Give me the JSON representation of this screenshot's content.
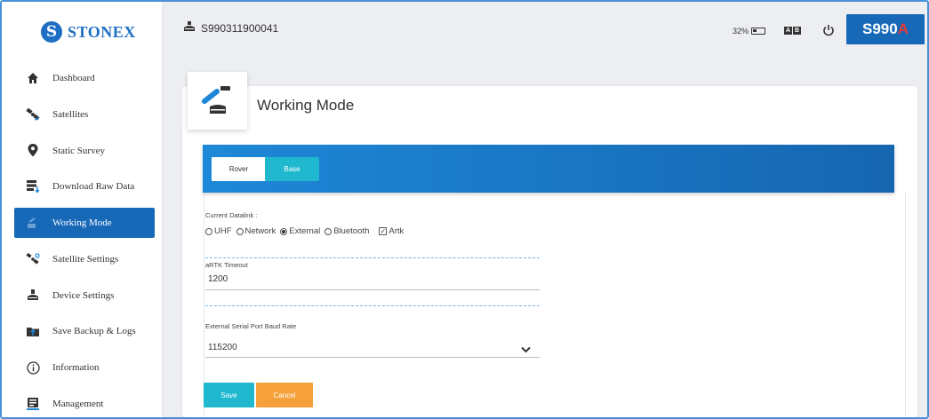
{
  "brand": {
    "name": "STONEX",
    "mark": "S",
    "color": "#1e6fc4"
  },
  "sidebar": {
    "items": [
      {
        "label": "Dashboard",
        "icon": "house-icon"
      },
      {
        "label": "Satellites",
        "icon": "satellite-icon"
      },
      {
        "label": "Static Survey",
        "icon": "location-pin-icon"
      },
      {
        "label": "Download Raw Data",
        "icon": "download-data-icon"
      },
      {
        "label": "Working Mode",
        "icon": "working-mode-icon",
        "active": true
      },
      {
        "label": "Satellite Settings",
        "icon": "satellite-settings-icon"
      },
      {
        "label": "Device Settings",
        "icon": "device-receiver-icon"
      },
      {
        "label": "Save Backup & Logs",
        "icon": "backup-folder-icon"
      },
      {
        "label": "Information",
        "icon": "info-icon"
      },
      {
        "label": "Management",
        "icon": "management-icon"
      }
    ]
  },
  "topbar": {
    "device_id": "S990311900041",
    "battery_text": "32%",
    "battery_level": 0.32,
    "lang_letters": [
      "A",
      "B"
    ],
    "model_prefix": "S990",
    "model_suffix": "A",
    "accent_color": "#1769b8"
  },
  "page": {
    "title": "Working Mode",
    "tabs": [
      {
        "label": "Rover",
        "selected": true
      },
      {
        "label": "Base",
        "selected": false
      }
    ],
    "datalink": {
      "label": "Current Datalink :",
      "options": [
        "UHF",
        "Network",
        "External",
        "Bluetooth"
      ],
      "selected": "External",
      "checkbox_label": "Artk",
      "checkbox_checked": true
    },
    "artk_timeout": {
      "label": "aRTK Timeout",
      "value": "1200"
    },
    "baud_rate": {
      "label": "External Serial Port Baud Rate",
      "value": "115200"
    },
    "buttons": {
      "save": "Save",
      "cancel": "Cancel"
    }
  }
}
